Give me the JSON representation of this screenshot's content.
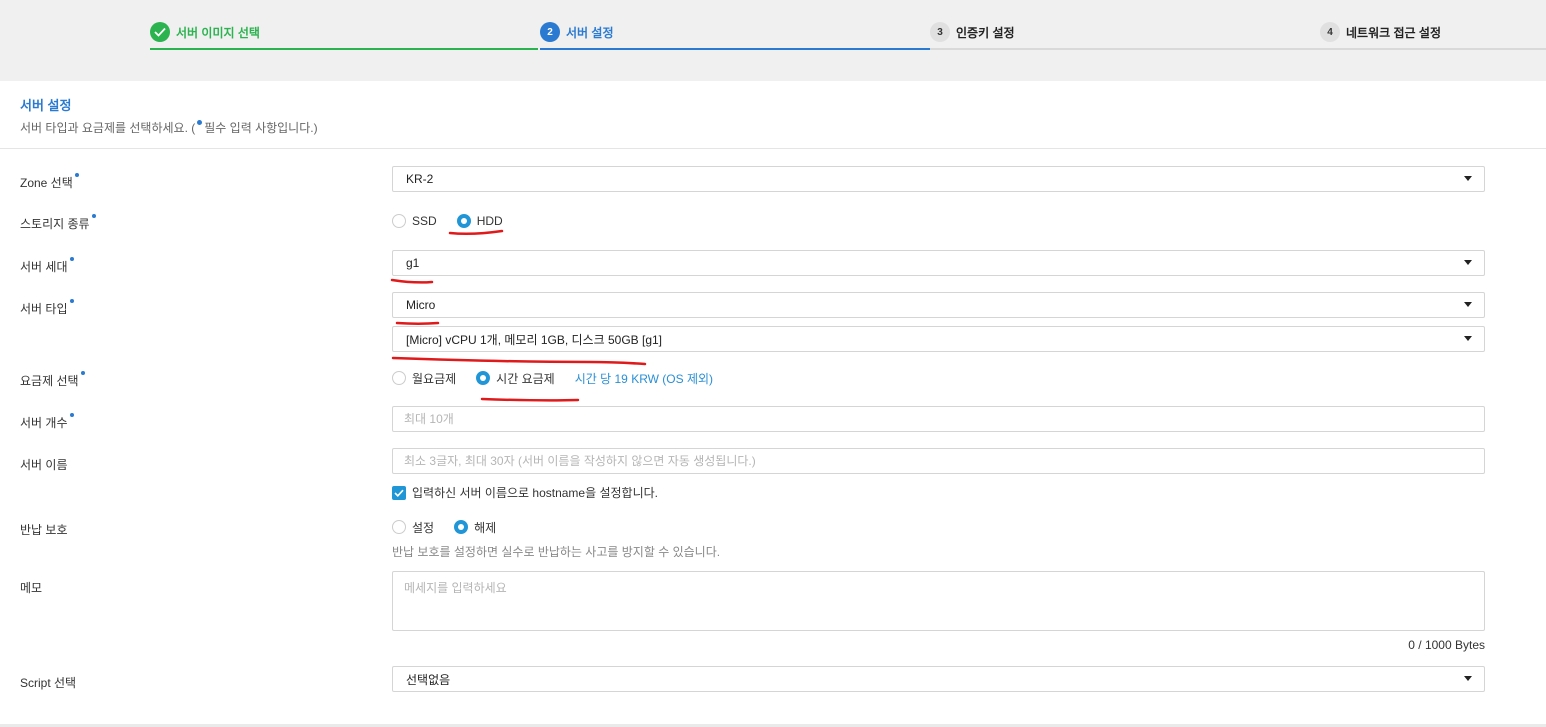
{
  "steps": [
    {
      "number": "",
      "label": "서버 이미지 선택",
      "state": "done"
    },
    {
      "number": "2",
      "label": "서버 설정",
      "state": "active"
    },
    {
      "number": "3",
      "label": "인증키 설정",
      "state": "pending"
    },
    {
      "number": "4",
      "label": "네트워크 접근 설정",
      "state": "pending"
    }
  ],
  "section": {
    "title": "서버 설정",
    "desc_before": "서버 타입과 요금제를 선택하세요. (",
    "desc_after": "필수 입력 사항입니다.)"
  },
  "form": {
    "zone": {
      "label": "Zone 선택",
      "value": "KR-2"
    },
    "storage": {
      "label": "스토리지 종류",
      "options": [
        "SSD",
        "HDD"
      ],
      "selected": "HDD"
    },
    "generation": {
      "label": "서버 세대",
      "value": "g1"
    },
    "server_type": {
      "label": "서버 타입",
      "value": "Micro",
      "spec_value": "[Micro] vCPU 1개, 메모리 1GB, 디스크 50GB [g1]"
    },
    "plan": {
      "label": "요금제 선택",
      "options": [
        "월요금제",
        "시간 요금제"
      ],
      "selected": "시간 요금제",
      "price_note": "시간 당 19 KRW (OS 제외)"
    },
    "count": {
      "label": "서버 개수",
      "placeholder": "최대 10개"
    },
    "name": {
      "label": "서버 이름",
      "placeholder": "최소 3글자, 최대 30자 (서버 이름을 작성하지 않으면 자동 생성됩니다.)",
      "hostname_checkbox": "입력하신 서버 이름으로 hostname을 설정합니다.",
      "hostname_checked": true
    },
    "return_protect": {
      "label": "반납 보호",
      "options": [
        "설정",
        "해제"
      ],
      "selected": "해제",
      "help": "반납 보호를 설정하면 실수로 반납하는 사고를 방지할 수 있습니다."
    },
    "memo": {
      "label": "메모",
      "placeholder": "메세지를 입력하세요",
      "counter": "0 / 1000 Bytes"
    },
    "script": {
      "label": "Script 선택",
      "value": "선택없음"
    }
  },
  "colors": {
    "accent": "#2a7ad1",
    "done": "#2bb34f",
    "radio": "#2196d6",
    "annotation": "#e0191b"
  }
}
